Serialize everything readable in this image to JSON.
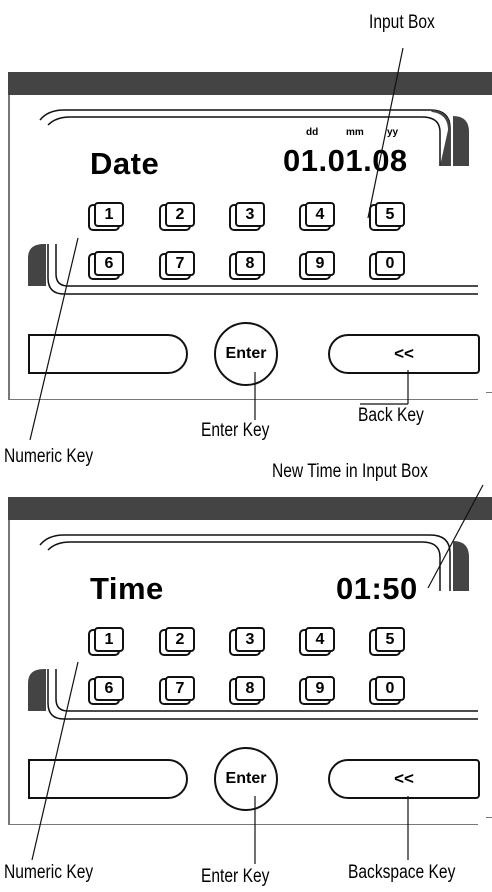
{
  "panels": [
    {
      "title": "Date",
      "value": "01.01.08",
      "date_format": [
        "dd",
        "mm",
        "yy"
      ],
      "keys_row1": [
        "1",
        "2",
        "3",
        "4",
        "5"
      ],
      "keys_row2": [
        "6",
        "7",
        "8",
        "9",
        "0"
      ],
      "enter_label": "Enter",
      "back_label": "<<"
    },
    {
      "title": "Time",
      "value": "01:50",
      "keys_row1": [
        "1",
        "2",
        "3",
        "4",
        "5"
      ],
      "keys_row2": [
        "6",
        "7",
        "8",
        "9",
        "0"
      ],
      "enter_label": "Enter",
      "back_label": "<<"
    }
  ],
  "callouts": {
    "input_box": "Input Box",
    "enter_key_1": "Enter Key",
    "back_key": "Back Key",
    "numeric_key_1": "Numeric Key",
    "new_time": "New Time in Input Box",
    "numeric_key_2": "Numeric Key",
    "enter_key_2": "Enter Key",
    "backspace_key": "Backspace Key"
  }
}
